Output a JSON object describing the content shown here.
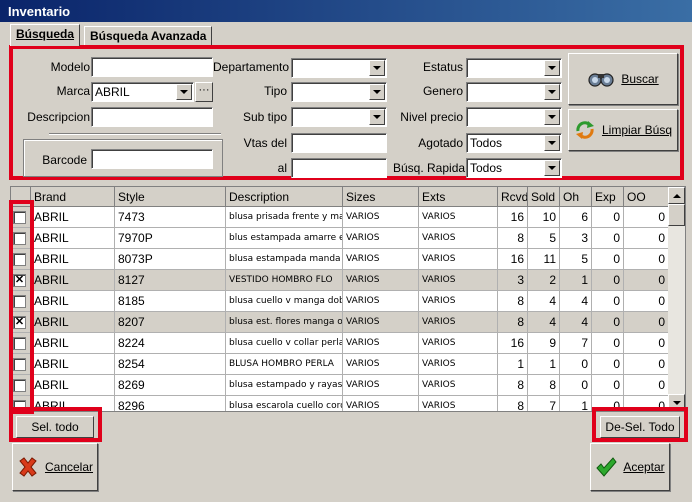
{
  "window": {
    "title": "Inventario"
  },
  "tabs": [
    {
      "label": "Búsqueda"
    },
    {
      "label": "Búsqueda Avanzada"
    }
  ],
  "search": {
    "modelo_label": "Modelo",
    "modelo_value": "",
    "marca_label": "Marca",
    "marca_value": "ABRIL",
    "marca_more": "···",
    "descripcion_label": "Descripcion",
    "descripcion_value": "",
    "barcode_label": "Barcode",
    "barcode_value": "",
    "departamento_label": "Departamento",
    "departamento_value": "",
    "tipo_label": "Tipo",
    "tipo_value": "",
    "subtipo_label": "Sub tipo",
    "subtipo_value": "",
    "vtas_del_label": "Vtas del",
    "vtas_del_value": "",
    "al_label": "al",
    "al_value": "",
    "estatus_label": "Estatus",
    "estatus_value": "",
    "genero_label": "Genero",
    "genero_value": "",
    "nivel_precio_label": "Nivel precio",
    "nivel_precio_value": "",
    "agotado_label": "Agotado",
    "agotado_value": "Todos",
    "busq_rapida_label": "Búsq. Rapida",
    "busq_rapida_value": "Todos",
    "buscar_label": "Buscar",
    "limpiar_label": "Limpiar Búsq"
  },
  "table": {
    "columns": [
      "Brand",
      "Style",
      "Description",
      "Sizes",
      "Exts",
      "Rcvd",
      "Sold",
      "Oh",
      "Exp",
      "OO"
    ],
    "rows": [
      {
        "checked": false,
        "brand": "ABRIL",
        "style": "7473",
        "description": "blusa prisada frente y manga",
        "sizes": "VARIOS",
        "exts": "VARIOS",
        "rcvd": "16",
        "sold": "10",
        "oh": "6",
        "exp": "0",
        "oo": "0"
      },
      {
        "checked": false,
        "brand": "ABRIL",
        "style": "7970P",
        "description": "blus estampada amarre en",
        "sizes": "VARIOS",
        "exts": "VARIOS",
        "rcvd": "8",
        "sold": "5",
        "oh": "3",
        "exp": "0",
        "oo": "0"
      },
      {
        "checked": false,
        "brand": "ABRIL",
        "style": "8073P",
        "description": "blusa estampada manda e",
        "sizes": "VARIOS",
        "exts": "VARIOS",
        "rcvd": "16",
        "sold": "11",
        "oh": "5",
        "exp": "0",
        "oo": "0"
      },
      {
        "checked": true,
        "brand": "ABRIL",
        "style": "8127",
        "description": "VESTIDO HOMBRO FLO",
        "sizes": "VARIOS",
        "exts": "VARIOS",
        "rcvd": "3",
        "sold": "2",
        "oh": "1",
        "exp": "0",
        "oo": "0"
      },
      {
        "checked": false,
        "brand": "ABRIL",
        "style": "8185",
        "description": "blusa cuello v manga doble",
        "sizes": "VARIOS",
        "exts": "VARIOS",
        "rcvd": "8",
        "sold": "4",
        "oh": "4",
        "exp": "0",
        "oo": "0"
      },
      {
        "checked": true,
        "brand": "ABRIL",
        "style": "8207",
        "description": "blusa est. flores manga ola",
        "sizes": "VARIOS",
        "exts": "VARIOS",
        "rcvd": "8",
        "sold": "4",
        "oh": "4",
        "exp": "0",
        "oo": "0"
      },
      {
        "checked": false,
        "brand": "ABRIL",
        "style": "8224",
        "description": "blusa cuello v collar perla",
        "sizes": "VARIOS",
        "exts": "VARIOS",
        "rcvd": "16",
        "sold": "9",
        "oh": "7",
        "exp": "0",
        "oo": "0"
      },
      {
        "checked": false,
        "brand": "ABRIL",
        "style": "8254",
        "description": "BLUSA HOMBRO PERLA",
        "sizes": "VARIOS",
        "exts": "VARIOS",
        "rcvd": "1",
        "sold": "1",
        "oh": "0",
        "exp": "0",
        "oo": "0"
      },
      {
        "checked": false,
        "brand": "ABRIL",
        "style": "8269",
        "description": "blusa estampado y rayas r",
        "sizes": "VARIOS",
        "exts": "VARIOS",
        "rcvd": "8",
        "sold": "8",
        "oh": "0",
        "exp": "0",
        "oo": "0"
      },
      {
        "checked": false,
        "brand": "ABRIL",
        "style": "8296",
        "description": "blusa escarola cuello cordo",
        "sizes": "VARIOS",
        "exts": "VARIOS",
        "rcvd": "8",
        "sold": "7",
        "oh": "1",
        "exp": "0",
        "oo": "0"
      }
    ]
  },
  "footer": {
    "select_all_label": "Sel. todo",
    "deselect_all_label": "De-Sel. Todo",
    "cancel_label": "Cancelar",
    "accept_label": "Aceptar"
  },
  "colors": {
    "highlight": "#e0001b",
    "title_bar": "#0a246a",
    "face": "#d4d0c8"
  }
}
